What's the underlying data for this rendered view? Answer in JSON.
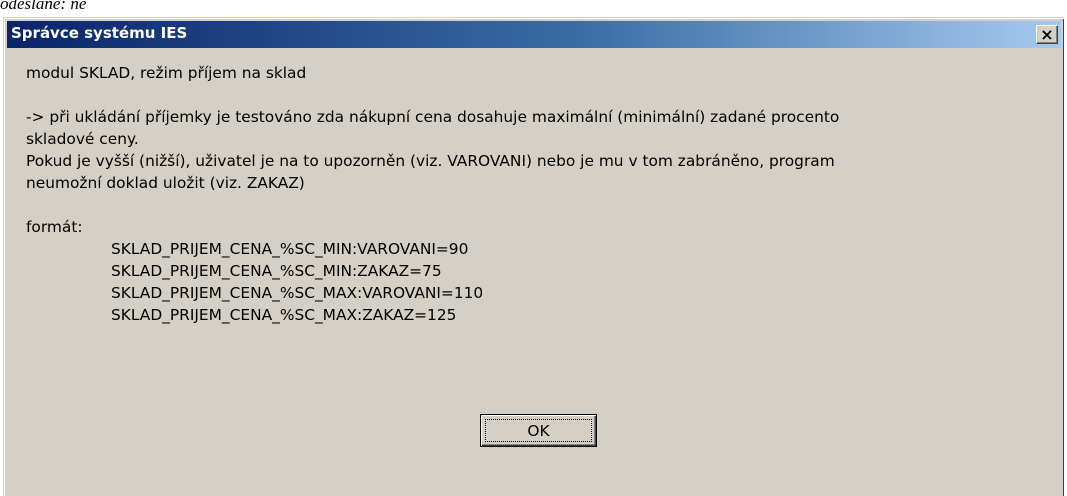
{
  "background": {
    "text": "odeslané: ne"
  },
  "dialog": {
    "title": "Správce systému IES",
    "close_glyph": "×",
    "close_icon": "close-icon",
    "lines": {
      "l1": "modul SKLAD, režim příjem na sklad",
      "l2": "-> při ukládání příjemky je testováno zda nákupní cena dosahuje maximální (minimální) zadané procento",
      "l3": "skladové ceny.",
      "l4": "Pokud je vyšší (nižší), uživatel je na to upozorněn (viz. VAROVANI) nebo je mu v tom zabráněno, program",
      "l5": "neumožní doklad uložit (viz. ZAKAZ)",
      "l6": "formát:",
      "f1": "SKLAD_PRIJEM_CENA_%SC_MIN:VAROVANI=90",
      "f2": "SKLAD_PRIJEM_CENA_%SC_MIN:ZAKAZ=75",
      "f3": "SKLAD_PRIJEM_CENA_%SC_MAX:VAROVANI=110",
      "f4": "SKLAD_PRIJEM_CENA_%SC_MAX:ZAKAZ=125"
    },
    "ok_label": "OK"
  },
  "colors": {
    "title_start": "#0a246a",
    "title_end": "#a6caf0",
    "face": "#d4d0c8"
  }
}
